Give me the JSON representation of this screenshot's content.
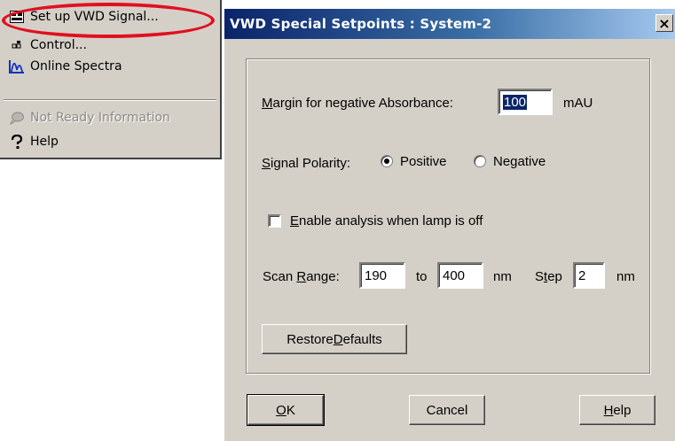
{
  "menu": {
    "items": [
      {
        "label": "Set up VWD Signal...",
        "icon": "signal-setup-icon"
      },
      {
        "label": "Control...",
        "icon": "control-icon"
      },
      {
        "label": "Online Spectra",
        "icon": "spectra-icon"
      },
      {
        "label": "Not Ready Information",
        "icon": "not-ready-icon",
        "disabled": true
      },
      {
        "label": "Help",
        "icon": "help-icon"
      }
    ],
    "highlight_color": "#e01020"
  },
  "dialog": {
    "title": "VWD Special Setpoints : System-2",
    "close_label": "×",
    "margin": {
      "label_u": "M",
      "label_rest": "argin for negative Absorbance:",
      "value": "100",
      "unit": "mAU"
    },
    "polarity": {
      "label_u": "S",
      "label_rest": "ignal Polarity:",
      "options": [
        "Positive",
        "Negative"
      ],
      "selected": "Positive"
    },
    "enable": {
      "label_u": "E",
      "label_rest": "nable analysis when lamp is off",
      "checked": false
    },
    "scan": {
      "label_pre": "Scan ",
      "label_u": "R",
      "label_rest": "ange:",
      "from": "190",
      "to_label": "to",
      "to": "400",
      "nm1": "nm",
      "step_pre": "S",
      "step_u": "t",
      "step_rest": "ep",
      "step": "2",
      "nm2": "nm"
    },
    "restore": {
      "pre": "Restore ",
      "u": "D",
      "rest": "efaults"
    },
    "buttons": {
      "ok": {
        "u": "O",
        "rest": "K"
      },
      "cancel": "Cancel",
      "help": {
        "u": "H",
        "rest": "elp"
      }
    }
  }
}
